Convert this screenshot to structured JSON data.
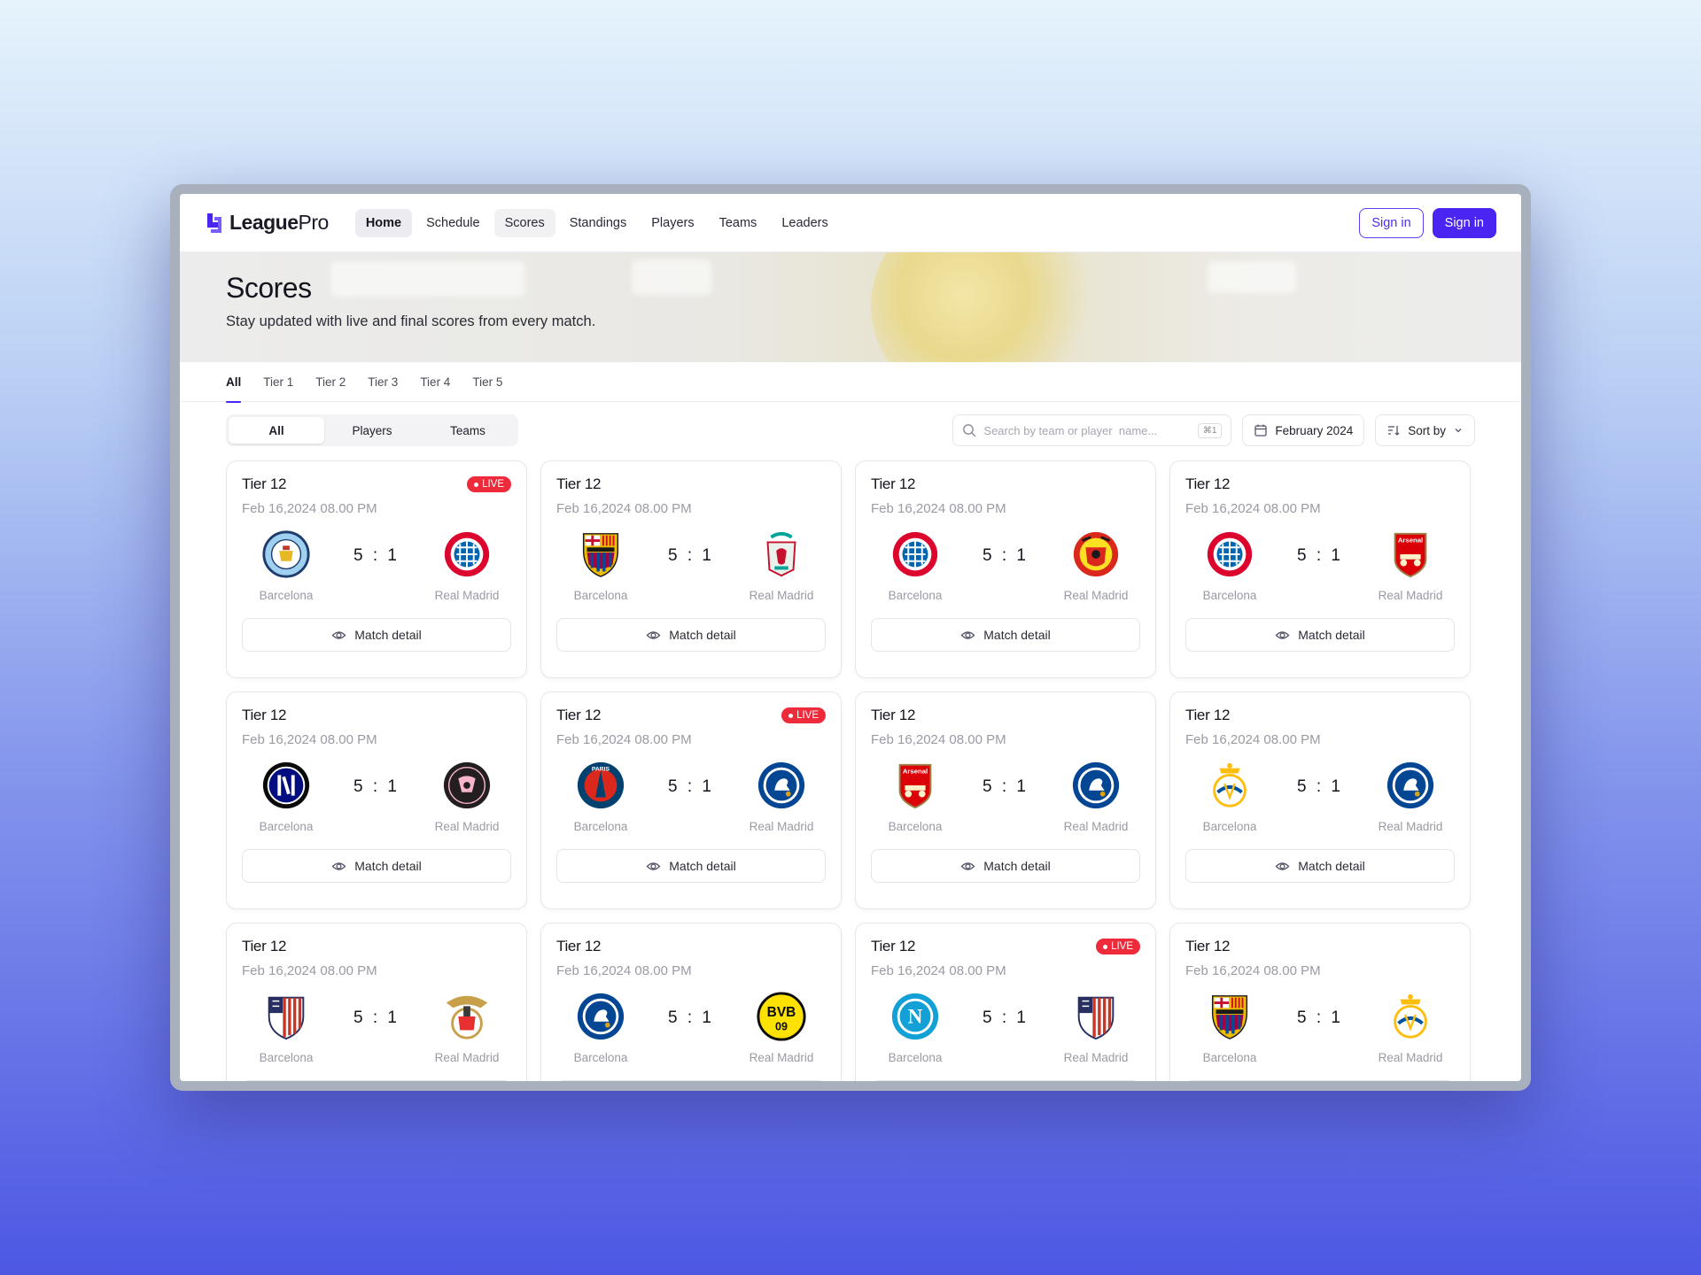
{
  "brand": {
    "name_main": "League",
    "name_sub": "Pro",
    "accent": "#4a24f0"
  },
  "nav": {
    "links": [
      "Home",
      "Schedule",
      "Scores",
      "Standings",
      "Players",
      "Teams",
      "Leaders"
    ],
    "active": "Home",
    "sign_in_outline": "Sign in",
    "sign_in_solid": "Sign in"
  },
  "hero": {
    "title": "Scores",
    "subtitle": "Stay updated with live and final scores from every match."
  },
  "tabs": [
    "All",
    "Tier 1",
    "Tier 2",
    "Tier 3",
    "Tier 4",
    "Tier 5"
  ],
  "segment": [
    "All",
    "Players",
    "Teams"
  ],
  "search": {
    "placeholder": "Search by team or player  name...",
    "shortcut": "⌘1"
  },
  "date_filter": "February 2024",
  "sort_label": "Sort by",
  "detail_label": "Match detail",
  "live_label": "LIVE",
  "matches": [
    {
      "tier": "Tier 12",
      "date": "Feb 16,2024 08.00 PM",
      "live": true,
      "home": "Barcelona",
      "away": "Real Madrid",
      "score": "5 : 1",
      "home_crest": "mancity-crest-icon",
      "away_crest": "bayern-crest-icon"
    },
    {
      "tier": "Tier 12",
      "date": "Feb 16,2024 08.00 PM",
      "live": false,
      "home": "Barcelona",
      "away": "Real Madrid",
      "score": "5 : 1",
      "home_crest": "barcelona-crest-icon",
      "away_crest": "liverpool-crest-icon"
    },
    {
      "tier": "Tier 12",
      "date": "Feb 16,2024 08.00 PM",
      "live": false,
      "home": "Barcelona",
      "away": "Real Madrid",
      "score": "5 : 1",
      "home_crest": "bayern-crest-icon",
      "away_crest": "manutd-crest-icon"
    },
    {
      "tier": "Tier 12",
      "date": "Feb 16,2024 08.00 PM",
      "live": false,
      "home": "Barcelona",
      "away": "Real Madrid",
      "score": "5 : 1",
      "home_crest": "bayern-crest-icon",
      "away_crest": "arsenal-crest-icon"
    },
    {
      "tier": "Tier 12",
      "date": "Feb 16,2024 08.00 PM",
      "live": false,
      "home": "Barcelona",
      "away": "Real Madrid",
      "score": "5 : 1",
      "home_crest": "inter-crest-icon",
      "away_crest": "intermiami-crest-icon"
    },
    {
      "tier": "Tier 12",
      "date": "Feb 16,2024 08.00 PM",
      "live": true,
      "home": "Barcelona",
      "away": "Real Madrid",
      "score": "5 : 1",
      "home_crest": "psg-crest-icon",
      "away_crest": "chelsea-crest-icon"
    },
    {
      "tier": "Tier 12",
      "date": "Feb 16,2024 08.00 PM",
      "live": false,
      "home": "Barcelona",
      "away": "Real Madrid",
      "score": "5 : 1",
      "home_crest": "arsenal-crest-icon",
      "away_crest": "chelsea-crest-icon"
    },
    {
      "tier": "Tier 12",
      "date": "Feb 16,2024 08.00 PM",
      "live": false,
      "home": "Barcelona",
      "away": "Real Madrid",
      "score": "5 : 1",
      "home_crest": "realmadrid-crest-icon",
      "away_crest": "chelsea-crest-icon"
    },
    {
      "tier": "Tier 12",
      "date": "Feb 16,2024 08.00 PM",
      "live": false,
      "home": "Barcelona",
      "away": "Real Madrid",
      "score": "5 : 1",
      "home_crest": "atletico-crest-icon",
      "away_crest": "benfica-crest-icon"
    },
    {
      "tier": "Tier 12",
      "date": "Feb 16,2024 08.00 PM",
      "live": false,
      "home": "Barcelona",
      "away": "Real Madrid",
      "score": "5 : 1",
      "home_crest": "chelsea-crest-icon",
      "away_crest": "dortmund-crest-icon"
    },
    {
      "tier": "Tier 12",
      "date": "Feb 16,2024 08.00 PM",
      "live": true,
      "home": "Barcelona",
      "away": "Real Madrid",
      "score": "5 : 1",
      "home_crest": "napoli-crest-icon",
      "away_crest": "atletico-crest-icon"
    },
    {
      "tier": "Tier 12",
      "date": "Feb 16,2024 08.00 PM",
      "live": false,
      "home": "Barcelona",
      "away": "Real Madrid",
      "score": "5 : 1",
      "home_crest": "barcelona-crest-icon",
      "away_crest": "realmadrid-crest-icon"
    }
  ]
}
